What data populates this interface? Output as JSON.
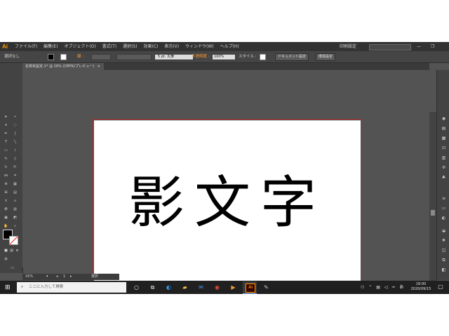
{
  "app": {
    "logo": "Ai"
  },
  "menu": {
    "items": [
      "ファイル(F)",
      "編集(E)",
      "オブジェクト(O)",
      "書式(T)",
      "選択(S)",
      "効果(C)",
      "表示(V)",
      "ウィンドウ(W)",
      "ヘルプ(H)"
    ],
    "workspace": "印刷設定",
    "window_controls": "— ❐ ✕"
  },
  "control_bar": {
    "selection": "選択なし",
    "stroke_label": "線 :",
    "brush_label": "5 pt. 丸筆",
    "opacity_label": "不透明度 :",
    "opacity_value": "100%",
    "style_label": "スタイル :",
    "doc_setup_button": "ドキュメント設定",
    "preferences_button": "環境設定"
  },
  "document": {
    "tab_title": "名称未設定-1* @ 16% (CMYK/プレビュー)",
    "close_glyph": "×"
  },
  "artwork": {
    "text": "影文字"
  },
  "status": {
    "zoom": "16%",
    "page": "1",
    "mode": "選択"
  },
  "taskbar": {
    "search_placeholder": "ここに入力して検索",
    "time": "18:00",
    "date": "2020/09/15",
    "ime": "あ"
  },
  "colors": {
    "ui_bg": "#535353",
    "panel_bg": "#434343",
    "accent_ai": "#ff9a00",
    "artboard_border": "#b32a2a"
  }
}
